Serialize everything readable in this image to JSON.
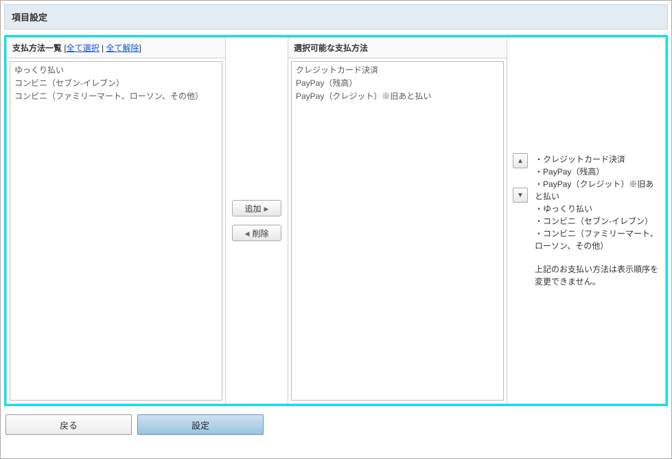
{
  "header": {
    "title": "項目設定"
  },
  "left_panel": {
    "title": "支払方法一覧",
    "select_all_label": "全て選択",
    "deselect_all_label": "全て解除",
    "items": [
      "ゆっくり払い",
      "コンビニ（セブン-イレブン）",
      "コンビニ（ファミリーマート、ローソン、その他）"
    ]
  },
  "center": {
    "add_label": "追加",
    "remove_label": "削除"
  },
  "right_panel": {
    "title": "選択可能な支払方法",
    "items": [
      "クレジットカード決済",
      "PayPay（残高）",
      "PayPay（クレジット）※旧あと払い"
    ]
  },
  "info": {
    "list": [
      "クレジットカード決済",
      "PayPay（残高）",
      "PayPay（クレジット）※旧あと払い",
      "ゆっくり払い",
      "コンビニ（セブン-イレブン）",
      "コンビニ（ファミリーマート、ローソン、その他）"
    ],
    "note": "上記のお支払い方法は表示順序を変更できません。"
  },
  "footer": {
    "back_label": "戻る",
    "submit_label": "設定"
  }
}
